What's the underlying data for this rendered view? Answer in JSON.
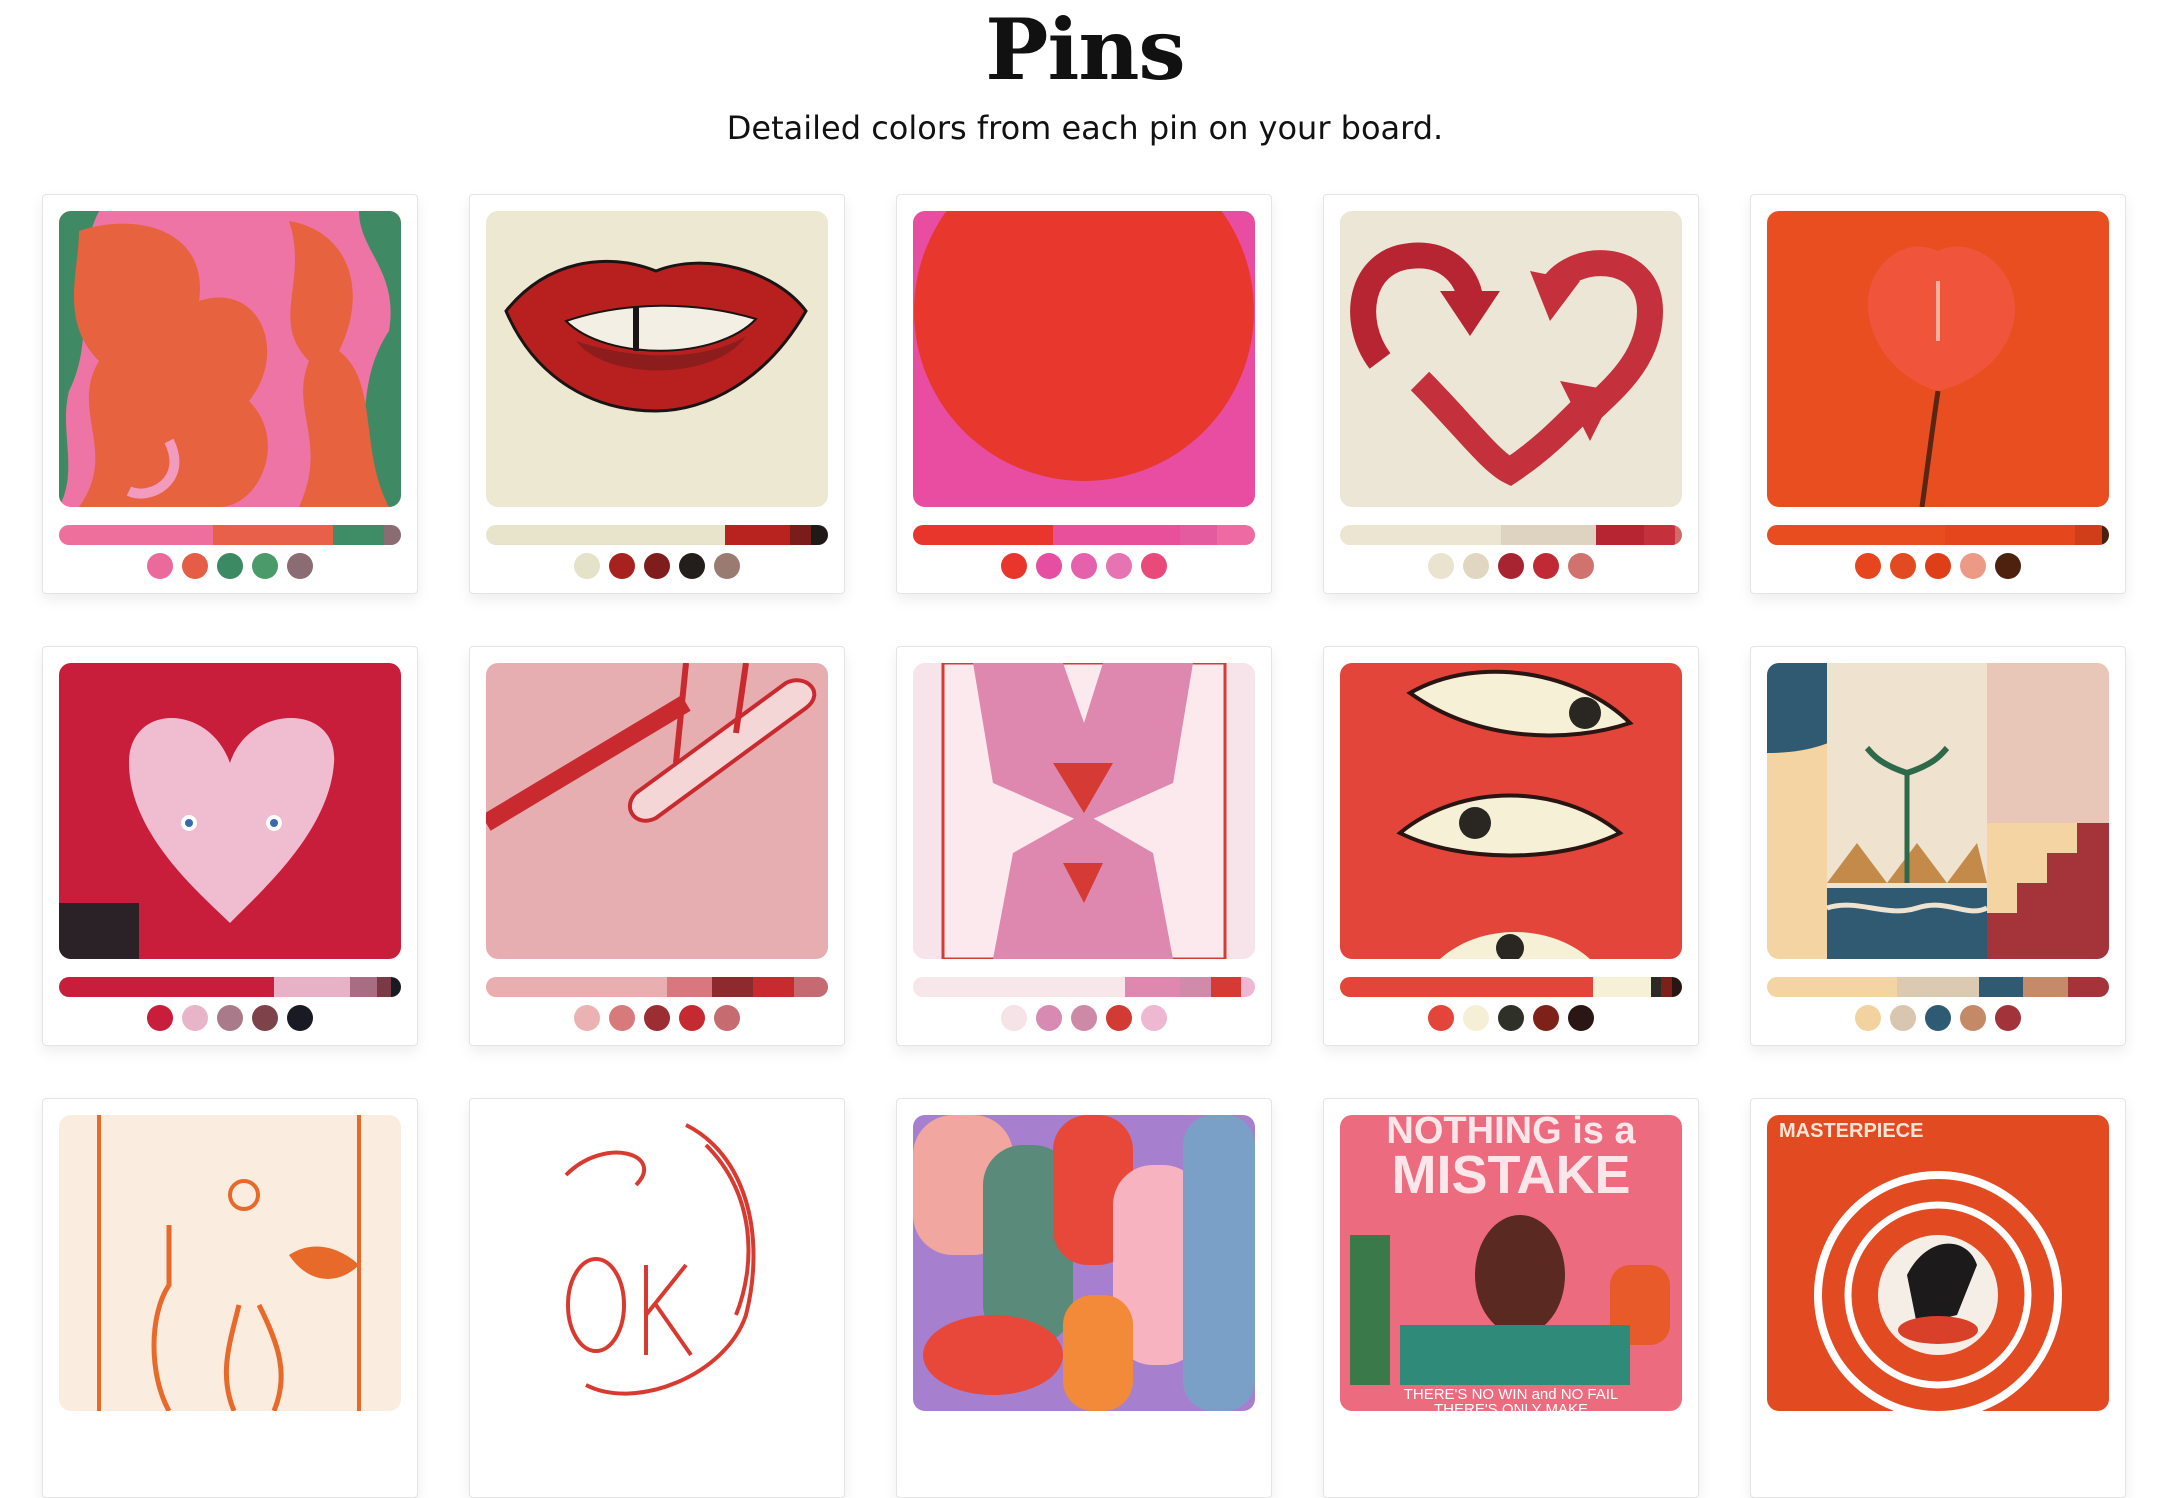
{
  "header": {
    "title": "Pins",
    "subtitle": "Detailed colors from each pin on your board."
  },
  "pins": [
    {
      "art": "abstract-figures",
      "bar": [
        [
          "#ee6e9c",
          0.45
        ],
        [
          "#e8604a",
          0.35
        ],
        [
          "#3f8d66",
          0.15
        ],
        [
          "#8a6c72",
          0.05
        ]
      ],
      "dots": [
        "#ea6b9b",
        "#e45d45",
        "#3c8a63",
        "#4a9a6a",
        "#8a6c72"
      ]
    },
    {
      "art": "lips",
      "bar": [
        [
          "#e8e4cc",
          0.7
        ],
        [
          "#b8221f",
          0.19
        ],
        [
          "#7a1c1a",
          0.06
        ],
        [
          "#1f1a18",
          0.05
        ]
      ],
      "dots": [
        "#e4e2c9",
        "#a7221f",
        "#7e1d1b",
        "#231d1b",
        "#9a7b72"
      ]
    },
    {
      "art": "red-sun",
      "bar": [
        [
          "#e9362c",
          0.41
        ],
        [
          "#e8509c",
          0.37
        ],
        [
          "#e45ba0",
          0.11
        ],
        [
          "#ee6aa2",
          0.11
        ]
      ],
      "dots": [
        "#e9362c",
        "#e54ea1",
        "#e661ab",
        "#e774b2",
        "#e84a7a"
      ]
    },
    {
      "art": "recycle-heart",
      "bar": [
        [
          "#ebe5d2",
          0.47
        ],
        [
          "#ded3c0",
          0.28
        ],
        [
          "#b82532",
          0.14
        ],
        [
          "#c4303c",
          0.09
        ],
        [
          "#d16a6a",
          0.02
        ]
      ],
      "dots": [
        "#e9e3cf",
        "#e0d6c1",
        "#a82430",
        "#c12a35",
        "#d0726e"
      ]
    },
    {
      "art": "anthurium",
      "bar": [
        [
          "#e84d20",
          0.52
        ],
        [
          "#e5461c",
          0.38
        ],
        [
          "#cf3e18",
          0.08
        ],
        [
          "#4a2010",
          0.02
        ]
      ],
      "dots": [
        "#e6451d",
        "#e24b22",
        "#df3f18",
        "#ec9a86",
        "#4e200e"
      ]
    },
    {
      "art": "heart-dish",
      "bar": [
        [
          "#c81e3b",
          0.63
        ],
        [
          "#e8b2c6",
          0.22
        ],
        [
          "#a86d82",
          0.08
        ],
        [
          "#7a3a45",
          0.04
        ],
        [
          "#1a1a22",
          0.03
        ]
      ],
      "dots": [
        "#c81e3b",
        "#e8b4c8",
        "#a87a8a",
        "#7e434a",
        "#1a1a24"
      ]
    },
    {
      "art": "skateboard",
      "bar": [
        [
          "#e9aeb0",
          0.53
        ],
        [
          "#d8787e",
          0.13
        ],
        [
          "#8c2a2e",
          0.12
        ],
        [
          "#c82a30",
          0.12
        ],
        [
          "#c66a72",
          0.1
        ]
      ],
      "dots": [
        "#eab2b2",
        "#d77a7c",
        "#9a2e32",
        "#c52a30",
        "#c66b6f"
      ]
    },
    {
      "art": "queen-card",
      "bar": [
        [
          "#f7e6ea",
          0.62
        ],
        [
          "#de88b0",
          0.16
        ],
        [
          "#d08aaa",
          0.09
        ],
        [
          "#d63a34",
          0.09
        ],
        [
          "#eeb7d4",
          0.04
        ]
      ],
      "dots": [
        "#f6e3e8",
        "#d88ab2",
        "#cc8aa6",
        "#d23a34",
        "#eeb7d2"
      ]
    },
    {
      "art": "eyes",
      "bar": [
        [
          "#e4453b",
          0.74
        ],
        [
          "#f6f0d6",
          0.17
        ],
        [
          "#2c2a24",
          0.03
        ],
        [
          "#7b2119",
          0.03
        ],
        [
          "#2a1512",
          0.03
        ]
      ],
      "dots": [
        "#e4453b",
        "#f5efd6",
        "#2f3128",
        "#7e2219",
        "#2a1614"
      ]
    },
    {
      "art": "mediterranean",
      "bar": [
        [
          "#f3d4a2",
          0.38
        ],
        [
          "#dcc9b2",
          0.24
        ],
        [
          "#2f5a72",
          0.13
        ],
        [
          "#c48a6a",
          0.13
        ],
        [
          "#a4343a",
          0.12
        ]
      ],
      "dots": [
        "#f2d3a0",
        "#d9c6b0",
        "#2e5a74",
        "#c48a68",
        "#a3333a"
      ]
    },
    {
      "art": "vases",
      "bar": [],
      "dots": []
    },
    {
      "art": "ok-hand",
      "bar": [],
      "dots": []
    },
    {
      "art": "abstract-shapes",
      "bar": [],
      "dots": []
    },
    {
      "art": "nothing-mistake",
      "bar": [],
      "dots": [],
      "text1": "NOTHING is a",
      "text2": "MISTAKE",
      "text3": "THERE'S NO WIN and NO FAIL",
      "text4": "THERE'S ONLY MAKE"
    },
    {
      "art": "vertigo",
      "bar": [],
      "dots": [],
      "text1": "MASTERPIECE"
    }
  ]
}
